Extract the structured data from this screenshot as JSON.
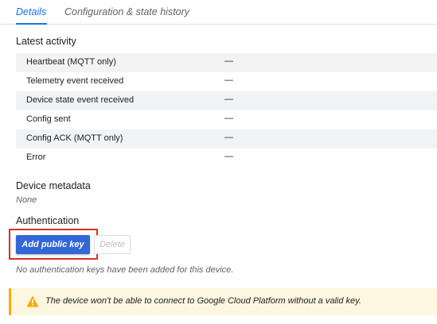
{
  "tabs": [
    {
      "label": "Details",
      "active": true
    },
    {
      "label": "Configuration & state history",
      "active": false
    }
  ],
  "latest_activity": {
    "title": "Latest activity",
    "rows": [
      {
        "label": "Heartbeat (MQTT only)",
        "value": "—"
      },
      {
        "label": "Telemetry event received",
        "value": "—"
      },
      {
        "label": "Device state event received",
        "value": "—"
      },
      {
        "label": "Config sent",
        "value": "—"
      },
      {
        "label": "Config ACK (MQTT only)",
        "value": "—"
      },
      {
        "label": "Error",
        "value": "—"
      }
    ]
  },
  "device_metadata": {
    "title": "Device metadata",
    "value": "None"
  },
  "authentication": {
    "title": "Authentication",
    "add_button": "Add public key",
    "delete_button": "Delete",
    "empty_message": "No authentication keys have been added for this device."
  },
  "warning": {
    "icon": "warning-icon",
    "message": "The device won't be able to connect to Google Cloud Platform without a valid key."
  },
  "colors": {
    "accent": "#1a73e8",
    "primary_button": "#3367d6",
    "highlight": "#d93025",
    "warning_bg": "#fef7e0",
    "warning_icon": "#f9ab00"
  }
}
